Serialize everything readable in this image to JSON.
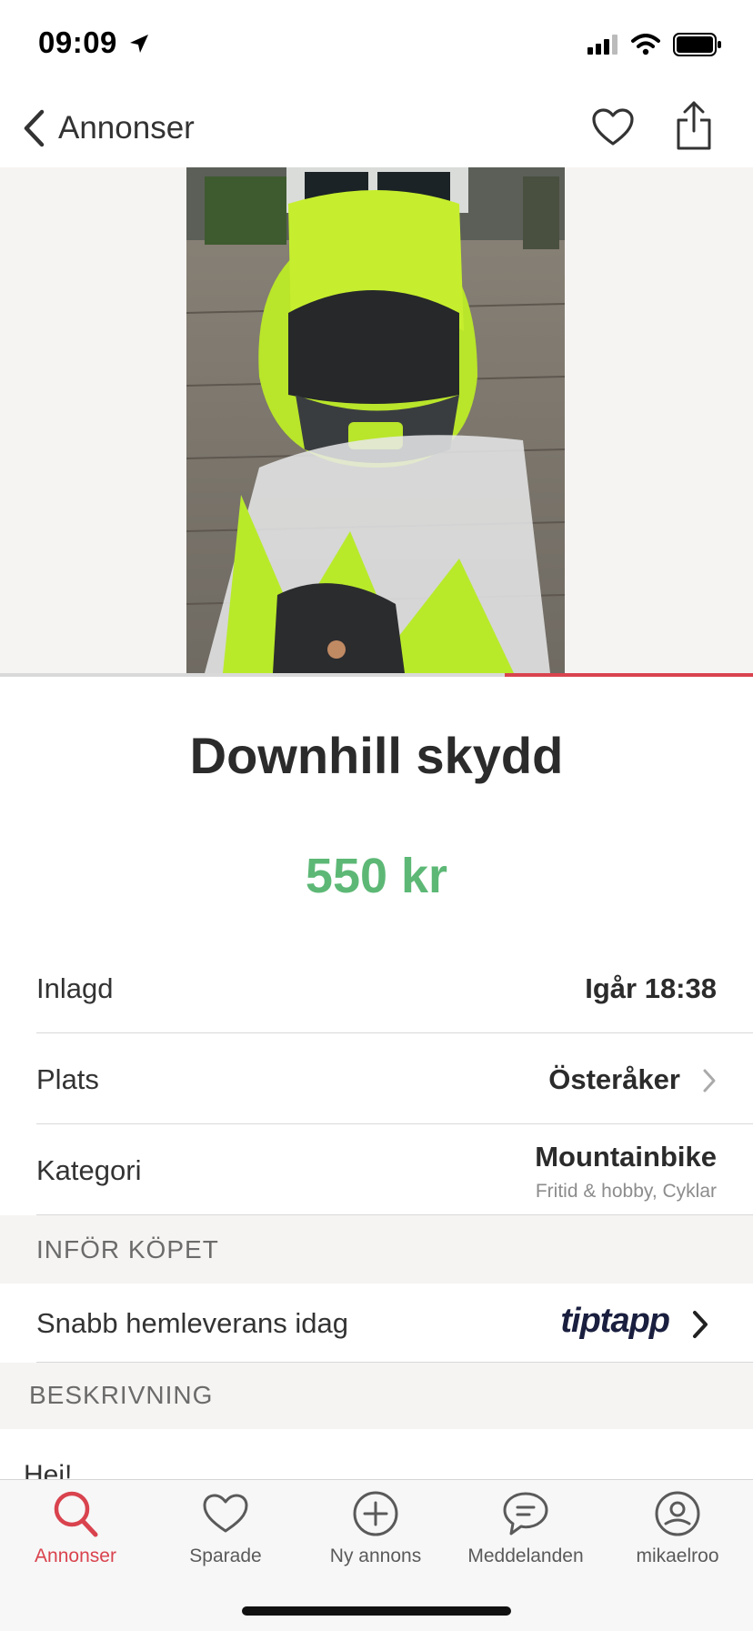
{
  "status": {
    "time": "09:09"
  },
  "nav": {
    "back_label": "Annonser"
  },
  "gallery": {
    "progress": 0.33
  },
  "listing": {
    "title": "Downhill skydd",
    "price": "550 kr",
    "details": [
      {
        "label": "Inlagd",
        "value": "Igår 18:38"
      },
      {
        "label": "Plats",
        "value": "Österåker"
      },
      {
        "label": "Kategori",
        "value": "Mountainbike",
        "subvalue": "Fritid & hobby, Cyklar"
      }
    ]
  },
  "before_purchase": {
    "heading": "INFÖR KÖPET",
    "delivery_label": "Snabb hemleverans idag",
    "partner": "tiptapp"
  },
  "description": {
    "heading": "BESKRIVNING",
    "preview": "Hej!"
  },
  "tabs": [
    {
      "label": "Annonser",
      "icon": "search-icon",
      "active": true
    },
    {
      "label": "Sparade",
      "icon": "heart-icon",
      "active": false
    },
    {
      "label": "Ny annons",
      "icon": "plus-circle-icon",
      "active": false
    },
    {
      "label": "Meddelanden",
      "icon": "chat-icon",
      "active": false
    },
    {
      "label": "mikaelroo",
      "icon": "profile-icon",
      "active": false
    }
  ],
  "colors": {
    "accent": "#d9434e",
    "price": "#5db876"
  }
}
